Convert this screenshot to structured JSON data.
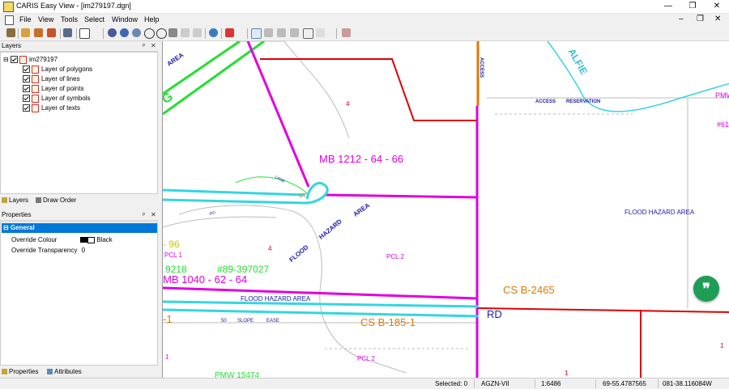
{
  "window": {
    "title": "CARIS Easy View - [im279197.dgn]",
    "minimize": "—",
    "restore": "❐",
    "close": "✕"
  },
  "menu": {
    "items": [
      "File",
      "View",
      "Tools",
      "Select",
      "Window",
      "Help"
    ],
    "mdi_min": "–",
    "mdi_restore": "❐",
    "mdi_close": "✕"
  },
  "layers_panel": {
    "title": "Layers",
    "pin": "ᵖ",
    "close": "✕",
    "root": "im279197",
    "items": [
      "Layer of polygons",
      "Layer of lines",
      "Layer of points",
      "Layer of symbols",
      "Layer of texts"
    ],
    "tab_layers": "Layers",
    "tab_draw_order": "Draw Order"
  },
  "properties_panel": {
    "title": "Properties",
    "group": "General",
    "override_colour_label": "Override Colour",
    "override_colour_value": "Black",
    "override_transparency_label": "Override Transparency",
    "override_transparency_value": "0",
    "tab_properties": "Properties",
    "tab_attributes": "Attributes"
  },
  "map": {
    "labels": {
      "area_top": "AREA",
      "access": "ACCESS",
      "access2": "ACCESS",
      "reservation": "RESERVATION",
      "alfie": "ALFIE",
      "pmw": "PMW",
      "num_61": "#61",
      "num_4a": "4",
      "mb_1212": "MB   1212 - 64 - 66",
      "ct": "CT",
      "flood_hazard_area_r": "FLOOD HAZARD AREA",
      "area_mid": "AREA",
      "hazard": "HAZARD",
      "flood": "FLOOD",
      "num_4b": "4",
      "pcl2a": "PCL 2",
      "left_96": "- 96",
      "pcl1": "PCL 1",
      "n9218": "9218",
      "n89": "#89-397027",
      "mb_1040": "MB    1040    -    62    -    64",
      "cs_2465": "CS B-2465",
      "flood_hazard_area_b": "FLOOD HAZARD AREA",
      "rd": "RD",
      "left_1": "-1",
      "cs_185": "CS B-185-1",
      "slope": "SLOPE",
      "ease": "EASE",
      "n50": "50",
      "pcl2b": "PCL 2",
      "num_1a": "1",
      "num_1b": "1",
      "num_1c": "1",
      "pmw_bottom": "PMW   15474",
      "lane": "LANE",
      "road_small": "RD",
      "g": "G"
    }
  },
  "fab": {
    "glyph": "❞"
  },
  "status": {
    "selected": "Selected: 0",
    "projection": "AGZN-VII",
    "scale": "1:6486",
    "lat": "69-55.4787565",
    "lon": "081-38.116084W"
  },
  "colors": {
    "accent": "#0078d7",
    "magenta": "#e000e0",
    "cyan": "#33d6e0",
    "red": "#e00000",
    "green": "#22e030",
    "orange": "#e07800",
    "blue": "#1a1aa8",
    "fab": "#1e9e55"
  }
}
